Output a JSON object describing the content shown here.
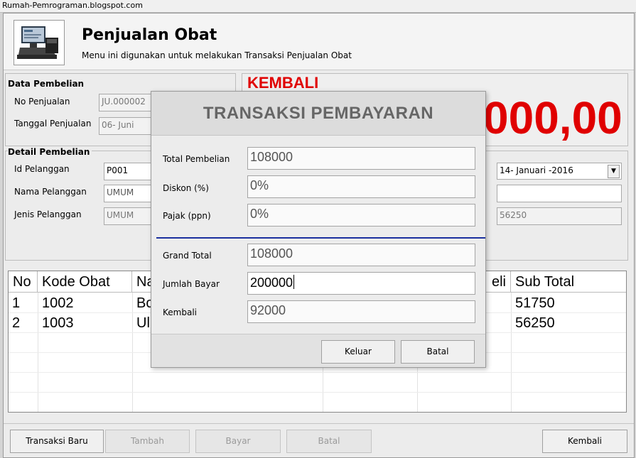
{
  "titlebar": {
    "url": "Rumah-Pemrograman.blogspot.com"
  },
  "header": {
    "title": "Penjualan Obat",
    "subtitle": "Menu ini digunakan untuk melakukan Transaksi Penjualan Obat"
  },
  "data_pembelian": {
    "section": "Data Pembelian",
    "no_penjualan_label": "No Penjualan",
    "no_penjualan_value": "JU.000002",
    "tanggal_label": "Tanggal Penjualan",
    "tanggal_value": "06-    Juni"
  },
  "kembali_display": {
    "label": "KEMBALI",
    "value": "000,00"
  },
  "detail_pembelian": {
    "section": "Detail Pembelian",
    "id_label": "Id Pelanggan",
    "id_value": "P001",
    "nama_label": "Nama Pelanggan",
    "nama_placeholder": "UMUM",
    "jenis_label": "Jenis Pelanggan",
    "jenis_placeholder": "UMUM",
    "date_combo": "14-  Januari  -2016",
    "right_field_2": "",
    "right_field_3": "56250"
  },
  "table": {
    "headers": [
      "No",
      "Kode Obat",
      "Na",
      "eli",
      "Sub Total"
    ],
    "rows": [
      {
        "no": "1",
        "kode": "1002",
        "nama": "Bo",
        "subtotal": "51750"
      },
      {
        "no": "2",
        "kode": "1003",
        "nama": "Ul",
        "subtotal": "56250"
      }
    ]
  },
  "bottom_buttons": {
    "transaksi_baru": "Transaksi Baru",
    "tambah": "Tambah",
    "bayar": "Bayar",
    "batal": "Batal",
    "kembali": "Kembali"
  },
  "modal": {
    "title": "TRANSAKSI PEMBAYARAN",
    "total_label": "Total Pembelian",
    "total_value": "108000",
    "diskon_label": "Diskon (%)",
    "diskon_value": "0%",
    "pajak_label": "Pajak (ppn)",
    "pajak_value": "0%",
    "grand_label": "Grand Total",
    "grand_value": "108000",
    "bayar_label": "Jumlah Bayar",
    "bayar_value": "200000",
    "kembali_label": "Kembali",
    "kembali_value": "92000",
    "keluar_button": "Keluar",
    "batal_button": "Batal"
  },
  "colors": {
    "accent_red": "#e00000",
    "separator_blue": "#1a2f9e"
  }
}
